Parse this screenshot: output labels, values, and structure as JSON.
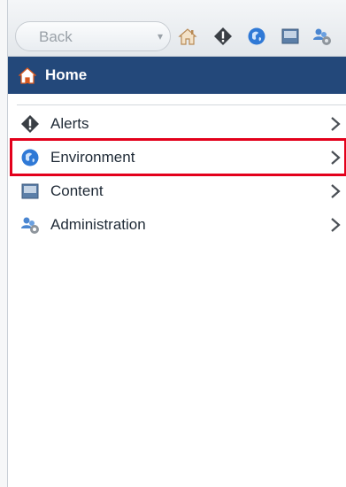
{
  "toolbar": {
    "back_label": "Back",
    "back_caret": "▾",
    "icons": [
      "home-icon",
      "alerts-icon",
      "environment-icon",
      "content-icon",
      "administration-icon"
    ]
  },
  "home": {
    "label": "Home",
    "icon": "home-icon"
  },
  "nav": {
    "items": [
      {
        "label": "Alerts",
        "icon": "alerts-icon"
      },
      {
        "label": "Environment",
        "icon": "environment-icon"
      },
      {
        "label": "Content",
        "icon": "content-icon"
      },
      {
        "label": "Administration",
        "icon": "administration-icon"
      }
    ]
  },
  "colors": {
    "homebar": "#23487a",
    "highlight": "#e3001b",
    "accent_blue": "#2f79d6",
    "alert_dark": "#3a3f45"
  }
}
